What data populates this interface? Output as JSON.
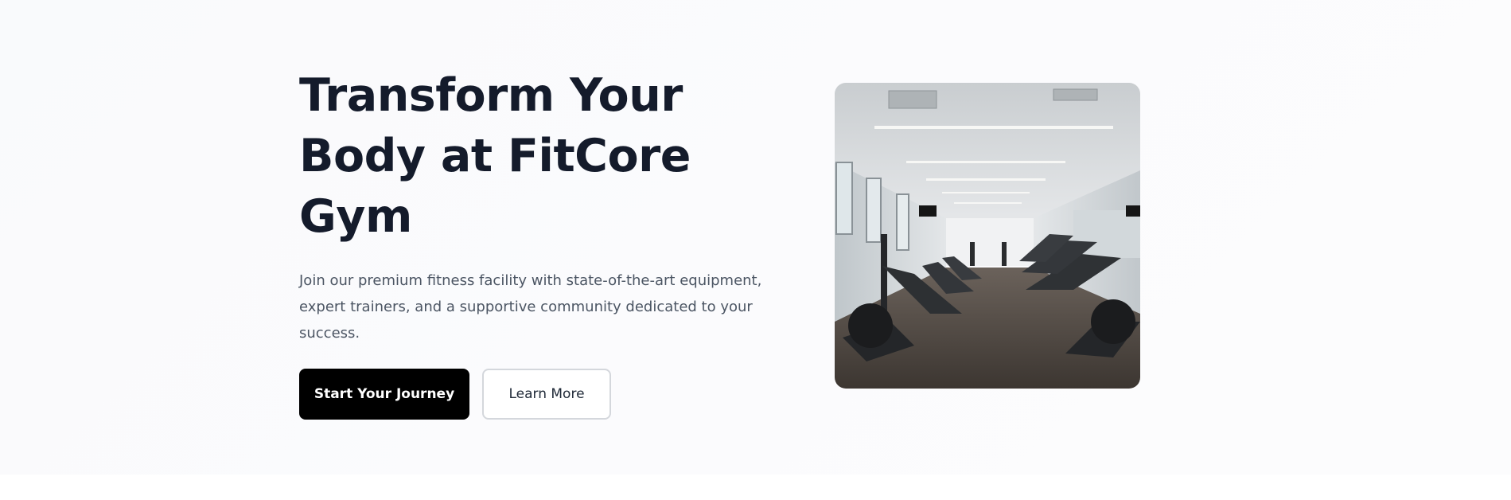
{
  "hero": {
    "title": "Transform Your Body at FitCore Gym",
    "description": "Join our premium fitness facility with state-of-the-art equipment, expert trainers, and a supportive community dedicated to your success.",
    "primary_button": "Start Your Journey",
    "secondary_button": "Learn More"
  },
  "colors": {
    "title": "#141b2b",
    "text": "#4b5563",
    "primary_bg": "#000000",
    "primary_text": "#ffffff",
    "secondary_border": "#d4d7dc"
  }
}
